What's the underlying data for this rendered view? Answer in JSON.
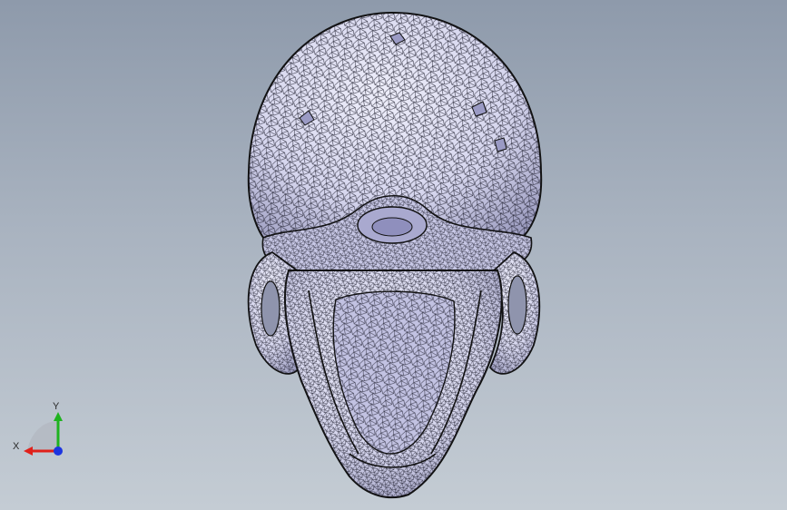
{
  "viewport": {
    "background_top": "#8e9aab",
    "background_bottom": "#c4ccd4",
    "model_fill": "#d6d6ee",
    "mesh_color": "#1b1b2a",
    "shadow_color": "#9d9dc0"
  },
  "triad": {
    "x_label": "X",
    "y_label": "Y",
    "x_color": "#e0201a",
    "y_color": "#1fb31f",
    "z_color": "#1c35e0"
  },
  "model": {
    "icon": "skull-mesh-icon"
  }
}
